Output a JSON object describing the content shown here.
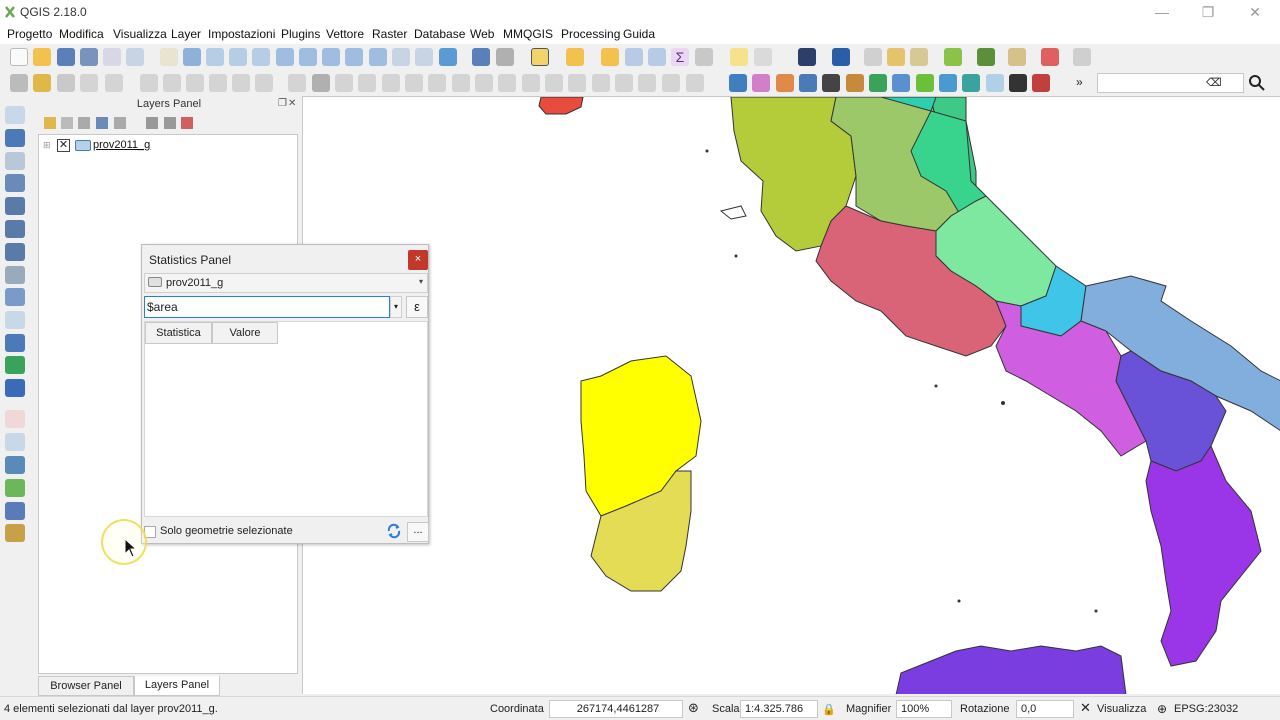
{
  "window": {
    "title": "QGIS 2.18.0",
    "controls": [
      "—",
      "❐",
      "✕"
    ]
  },
  "menu": [
    "Progetto",
    "Modifica",
    "Visualizza",
    "Layer",
    "Impostazioni",
    "Plugins",
    "Vettore",
    "Raster",
    "Database",
    "Web",
    "MMQGIS",
    "Processing",
    "Guida"
  ],
  "layers_panel": {
    "title": "Layers Panel",
    "layer_name": "prov2011_g"
  },
  "tabs": {
    "browser": "Browser Panel",
    "layers": "Layers Panel"
  },
  "stats_panel": {
    "title": "Statistics Panel",
    "close": "×",
    "layer": "prov2011_g",
    "field": "$area",
    "expr_symbol": "ε",
    "columns": [
      "Statistica",
      "Valore"
    ],
    "selected_only_label": "Solo geometrie selezionate",
    "more_label": "..."
  },
  "statusbar": {
    "message": "4 elementi selezionati dal layer prov2011_g.",
    "coord_label": "Coordinata",
    "coord_value": "267174,4461287",
    "scale_label": "Scala",
    "scale_value": "1:4.325.786",
    "magnifier_label": "Magnifier",
    "magnifier_value": "100%",
    "rotation_label": "Rotazione",
    "rotation_value": "0,0",
    "render_label": "Visualizza",
    "crs": "EPSG:23032"
  },
  "colors": {
    "accent": "#2a7ddb",
    "close_red": "#c0392b",
    "sardinia_selected": "#ffff00"
  }
}
